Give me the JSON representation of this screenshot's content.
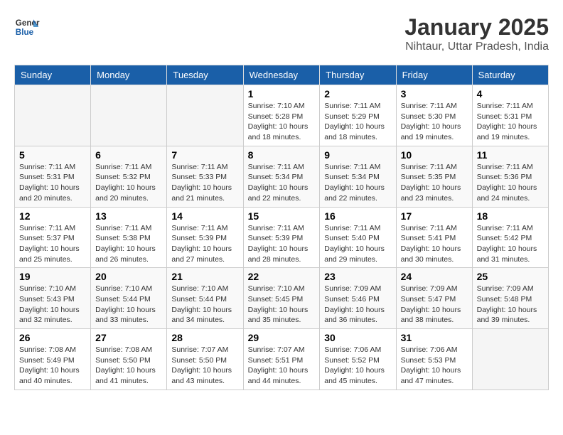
{
  "header": {
    "logo_line1": "General",
    "logo_line2": "Blue",
    "month_title": "January 2025",
    "location": "Nihtaur, Uttar Pradesh, India"
  },
  "days_of_week": [
    "Sunday",
    "Monday",
    "Tuesday",
    "Wednesday",
    "Thursday",
    "Friday",
    "Saturday"
  ],
  "weeks": [
    [
      {
        "day": "",
        "sunrise": "",
        "sunset": "",
        "daylight": ""
      },
      {
        "day": "",
        "sunrise": "",
        "sunset": "",
        "daylight": ""
      },
      {
        "day": "",
        "sunrise": "",
        "sunset": "",
        "daylight": ""
      },
      {
        "day": "1",
        "sunrise": "Sunrise: 7:10 AM",
        "sunset": "Sunset: 5:28 PM",
        "daylight": "Daylight: 10 hours and 18 minutes."
      },
      {
        "day": "2",
        "sunrise": "Sunrise: 7:11 AM",
        "sunset": "Sunset: 5:29 PM",
        "daylight": "Daylight: 10 hours and 18 minutes."
      },
      {
        "day": "3",
        "sunrise": "Sunrise: 7:11 AM",
        "sunset": "Sunset: 5:30 PM",
        "daylight": "Daylight: 10 hours and 19 minutes."
      },
      {
        "day": "4",
        "sunrise": "Sunrise: 7:11 AM",
        "sunset": "Sunset: 5:31 PM",
        "daylight": "Daylight: 10 hours and 19 minutes."
      }
    ],
    [
      {
        "day": "5",
        "sunrise": "Sunrise: 7:11 AM",
        "sunset": "Sunset: 5:31 PM",
        "daylight": "Daylight: 10 hours and 20 minutes."
      },
      {
        "day": "6",
        "sunrise": "Sunrise: 7:11 AM",
        "sunset": "Sunset: 5:32 PM",
        "daylight": "Daylight: 10 hours and 20 minutes."
      },
      {
        "day": "7",
        "sunrise": "Sunrise: 7:11 AM",
        "sunset": "Sunset: 5:33 PM",
        "daylight": "Daylight: 10 hours and 21 minutes."
      },
      {
        "day": "8",
        "sunrise": "Sunrise: 7:11 AM",
        "sunset": "Sunset: 5:34 PM",
        "daylight": "Daylight: 10 hours and 22 minutes."
      },
      {
        "day": "9",
        "sunrise": "Sunrise: 7:11 AM",
        "sunset": "Sunset: 5:34 PM",
        "daylight": "Daylight: 10 hours and 22 minutes."
      },
      {
        "day": "10",
        "sunrise": "Sunrise: 7:11 AM",
        "sunset": "Sunset: 5:35 PM",
        "daylight": "Daylight: 10 hours and 23 minutes."
      },
      {
        "day": "11",
        "sunrise": "Sunrise: 7:11 AM",
        "sunset": "Sunset: 5:36 PM",
        "daylight": "Daylight: 10 hours and 24 minutes."
      }
    ],
    [
      {
        "day": "12",
        "sunrise": "Sunrise: 7:11 AM",
        "sunset": "Sunset: 5:37 PM",
        "daylight": "Daylight: 10 hours and 25 minutes."
      },
      {
        "day": "13",
        "sunrise": "Sunrise: 7:11 AM",
        "sunset": "Sunset: 5:38 PM",
        "daylight": "Daylight: 10 hours and 26 minutes."
      },
      {
        "day": "14",
        "sunrise": "Sunrise: 7:11 AM",
        "sunset": "Sunset: 5:39 PM",
        "daylight": "Daylight: 10 hours and 27 minutes."
      },
      {
        "day": "15",
        "sunrise": "Sunrise: 7:11 AM",
        "sunset": "Sunset: 5:39 PM",
        "daylight": "Daylight: 10 hours and 28 minutes."
      },
      {
        "day": "16",
        "sunrise": "Sunrise: 7:11 AM",
        "sunset": "Sunset: 5:40 PM",
        "daylight": "Daylight: 10 hours and 29 minutes."
      },
      {
        "day": "17",
        "sunrise": "Sunrise: 7:11 AM",
        "sunset": "Sunset: 5:41 PM",
        "daylight": "Daylight: 10 hours and 30 minutes."
      },
      {
        "day": "18",
        "sunrise": "Sunrise: 7:11 AM",
        "sunset": "Sunset: 5:42 PM",
        "daylight": "Daylight: 10 hours and 31 minutes."
      }
    ],
    [
      {
        "day": "19",
        "sunrise": "Sunrise: 7:10 AM",
        "sunset": "Sunset: 5:43 PM",
        "daylight": "Daylight: 10 hours and 32 minutes."
      },
      {
        "day": "20",
        "sunrise": "Sunrise: 7:10 AM",
        "sunset": "Sunset: 5:44 PM",
        "daylight": "Daylight: 10 hours and 33 minutes."
      },
      {
        "day": "21",
        "sunrise": "Sunrise: 7:10 AM",
        "sunset": "Sunset: 5:44 PM",
        "daylight": "Daylight: 10 hours and 34 minutes."
      },
      {
        "day": "22",
        "sunrise": "Sunrise: 7:10 AM",
        "sunset": "Sunset: 5:45 PM",
        "daylight": "Daylight: 10 hours and 35 minutes."
      },
      {
        "day": "23",
        "sunrise": "Sunrise: 7:09 AM",
        "sunset": "Sunset: 5:46 PM",
        "daylight": "Daylight: 10 hours and 36 minutes."
      },
      {
        "day": "24",
        "sunrise": "Sunrise: 7:09 AM",
        "sunset": "Sunset: 5:47 PM",
        "daylight": "Daylight: 10 hours and 38 minutes."
      },
      {
        "day": "25",
        "sunrise": "Sunrise: 7:09 AM",
        "sunset": "Sunset: 5:48 PM",
        "daylight": "Daylight: 10 hours and 39 minutes."
      }
    ],
    [
      {
        "day": "26",
        "sunrise": "Sunrise: 7:08 AM",
        "sunset": "Sunset: 5:49 PM",
        "daylight": "Daylight: 10 hours and 40 minutes."
      },
      {
        "day": "27",
        "sunrise": "Sunrise: 7:08 AM",
        "sunset": "Sunset: 5:50 PM",
        "daylight": "Daylight: 10 hours and 41 minutes."
      },
      {
        "day": "28",
        "sunrise": "Sunrise: 7:07 AM",
        "sunset": "Sunset: 5:50 PM",
        "daylight": "Daylight: 10 hours and 43 minutes."
      },
      {
        "day": "29",
        "sunrise": "Sunrise: 7:07 AM",
        "sunset": "Sunset: 5:51 PM",
        "daylight": "Daylight: 10 hours and 44 minutes."
      },
      {
        "day": "30",
        "sunrise": "Sunrise: 7:06 AM",
        "sunset": "Sunset: 5:52 PM",
        "daylight": "Daylight: 10 hours and 45 minutes."
      },
      {
        "day": "31",
        "sunrise": "Sunrise: 7:06 AM",
        "sunset": "Sunset: 5:53 PM",
        "daylight": "Daylight: 10 hours and 47 minutes."
      },
      {
        "day": "",
        "sunrise": "",
        "sunset": "",
        "daylight": ""
      }
    ]
  ]
}
